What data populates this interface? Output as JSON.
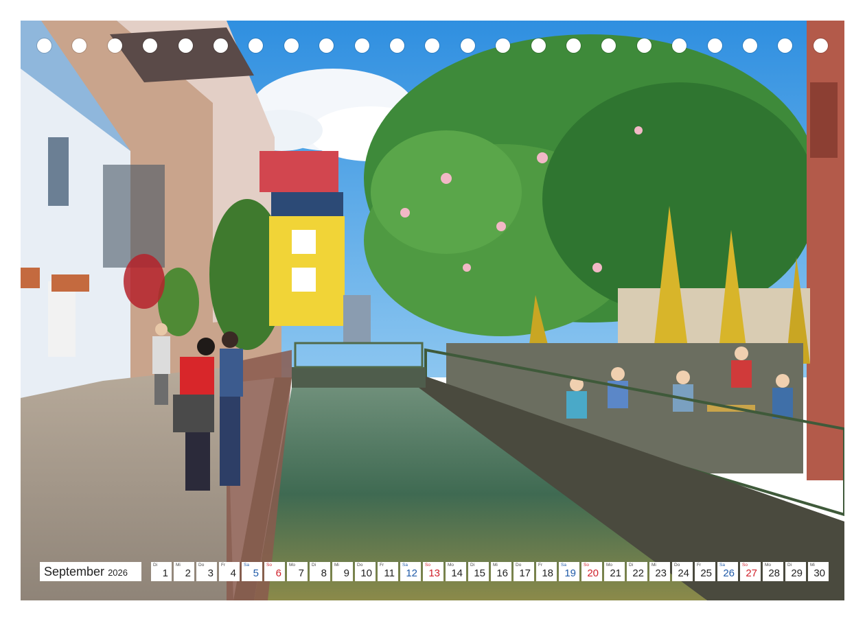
{
  "calendar": {
    "month": "September",
    "year": "2026",
    "days": [
      {
        "wd": "Di",
        "num": "1",
        "type": "weekday"
      },
      {
        "wd": "Mi",
        "num": "2",
        "type": "weekday"
      },
      {
        "wd": "Do",
        "num": "3",
        "type": "weekday"
      },
      {
        "wd": "Fr",
        "num": "4",
        "type": "weekday"
      },
      {
        "wd": "Sa",
        "num": "5",
        "type": "sat"
      },
      {
        "wd": "So",
        "num": "6",
        "type": "sun"
      },
      {
        "wd": "Mo",
        "num": "7",
        "type": "weekday"
      },
      {
        "wd": "Di",
        "num": "8",
        "type": "weekday"
      },
      {
        "wd": "Mi",
        "num": "9",
        "type": "weekday"
      },
      {
        "wd": "Do",
        "num": "10",
        "type": "weekday"
      },
      {
        "wd": "Fr",
        "num": "11",
        "type": "weekday"
      },
      {
        "wd": "Sa",
        "num": "12",
        "type": "sat"
      },
      {
        "wd": "So",
        "num": "13",
        "type": "sun"
      },
      {
        "wd": "Mo",
        "num": "14",
        "type": "weekday"
      },
      {
        "wd": "Di",
        "num": "15",
        "type": "weekday"
      },
      {
        "wd": "Mi",
        "num": "16",
        "type": "weekday"
      },
      {
        "wd": "Do",
        "num": "17",
        "type": "weekday"
      },
      {
        "wd": "Fr",
        "num": "18",
        "type": "weekday"
      },
      {
        "wd": "Sa",
        "num": "19",
        "type": "sat"
      },
      {
        "wd": "So",
        "num": "20",
        "type": "sun"
      },
      {
        "wd": "Mo",
        "num": "21",
        "type": "weekday"
      },
      {
        "wd": "Di",
        "num": "22",
        "type": "weekday"
      },
      {
        "wd": "Mi",
        "num": "23",
        "type": "weekday"
      },
      {
        "wd": "Do",
        "num": "24",
        "type": "weekday"
      },
      {
        "wd": "Fr",
        "num": "25",
        "type": "weekday"
      },
      {
        "wd": "Sa",
        "num": "26",
        "type": "sat"
      },
      {
        "wd": "So",
        "num": "27",
        "type": "sun"
      },
      {
        "wd": "Mo",
        "num": "28",
        "type": "weekday"
      },
      {
        "wd": "Di",
        "num": "29",
        "type": "weekday"
      },
      {
        "wd": "Mi",
        "num": "30",
        "type": "weekday"
      }
    ]
  },
  "colors": {
    "saturday": "#1f5aa8",
    "sunday": "#d0202a",
    "weekday": "#222222"
  }
}
